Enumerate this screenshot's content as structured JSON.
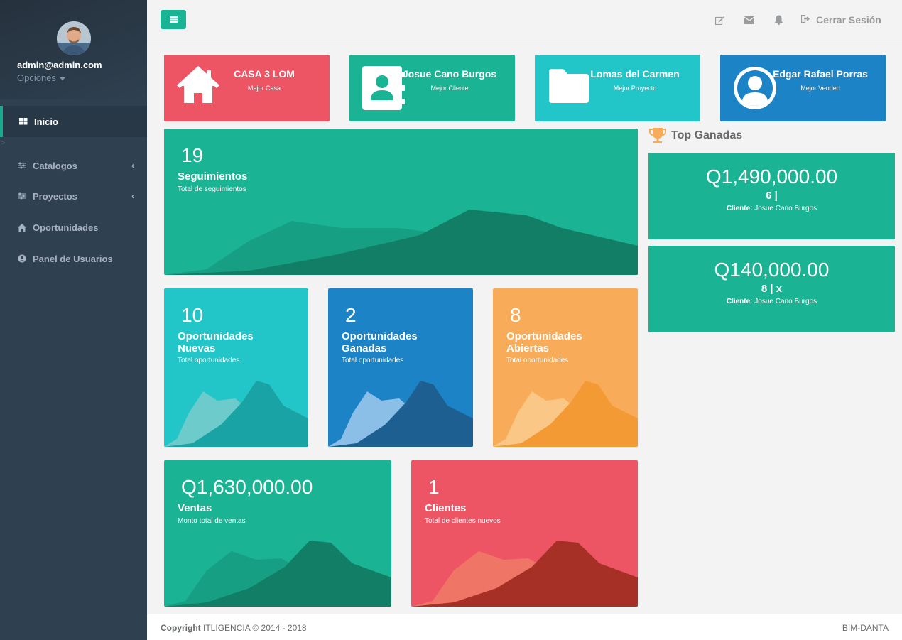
{
  "sidebar": {
    "profile": {
      "email": "admin@admin.com",
      "options_label": "Opciones"
    },
    "items": [
      {
        "label": "Inicio",
        "icon": "th-large-icon"
      },
      {
        "label": "Catalogos",
        "icon": "sliders-icon"
      },
      {
        "label": "Proyectos",
        "icon": "sliders-icon"
      },
      {
        "label": "Oportunidades",
        "icon": "home-icon"
      },
      {
        "label": "Panel de Usuarios",
        "icon": "user-circle-icon"
      }
    ],
    "mark": ">"
  },
  "topbar": {
    "logout_label": "Cerrar Sesión"
  },
  "top_cards": [
    {
      "title": "CASA 3 LOM",
      "subtitle": "Mejor Casa",
      "color": "#ed5565",
      "icon": "home-icon"
    },
    {
      "title": "Josue Cano Burgos",
      "subtitle": "Mejor Cliente",
      "color": "#1ab394",
      "icon": "address-book-icon"
    },
    {
      "title": "Lomas del Carmen",
      "subtitle": "Mejor Proyecto",
      "color": "#23c6c8",
      "icon": "folder-icon"
    },
    {
      "title": "Edgar Rafael Porras",
      "subtitle": "Mejor Vended",
      "color": "#1c84c6",
      "icon": "user-circle-icon"
    }
  ],
  "widgets": {
    "seguimientos": {
      "number": "19",
      "title": "Seguimientos",
      "subtitle": "Total de seguimientos"
    },
    "nuevas": {
      "number": "10",
      "title_line1": "Oportunidades",
      "title_line2": "Nuevas",
      "subtitle": "Total oportunidades"
    },
    "ganadas": {
      "number": "2",
      "title_line1": "Oportunidades",
      "title_line2": "Ganadas",
      "subtitle": "Total oportunidades"
    },
    "abiertas": {
      "number": "8",
      "title_line1": "Oportunidades",
      "title_line2": "Abiertas",
      "subtitle": "Total oportunidades"
    },
    "ventas": {
      "number": "Q1,630,000.00",
      "title": "Ventas",
      "subtitle": "Monto total de ventas"
    },
    "clientes": {
      "number": "1",
      "title": "Clientes",
      "subtitle": "Total de clientes nuevos"
    }
  },
  "top_ganadas": {
    "heading": "Top Ganadas",
    "items": [
      {
        "amount": "Q1,490,000.00",
        "detail": "6 |",
        "client_label": "Cliente:",
        "client": "Josue Cano Burgos"
      },
      {
        "amount": "Q140,000.00",
        "detail": "8 | x",
        "client_label": "Cliente:",
        "client": "Josue Cano Burgos"
      }
    ]
  },
  "footer": {
    "copyright_bold": "Copyright",
    "copyright_text": "ITLIGENCIA © 2014 - 2018",
    "right_text": "BIM-DANTA"
  },
  "colors": {
    "sidebar": "#2f4050",
    "green": "#1ab394",
    "red": "#ed5565",
    "cyan": "#23c6c8",
    "blue": "#1c84c6",
    "orange": "#f8ac59"
  }
}
